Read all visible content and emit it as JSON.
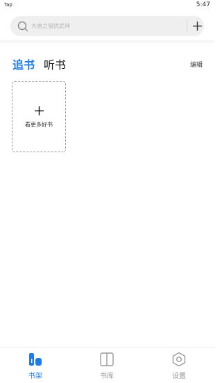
{
  "status_bar": {
    "carrier": "Tap",
    "time": "5:47"
  },
  "search": {
    "placeholder": "大唐之猫扰武神"
  },
  "icons": {
    "search": "search-icon",
    "add": "plus-icon",
    "add_book": "plus-icon",
    "bookshelf": "bookshelf-icon",
    "library": "book-open-icon",
    "settings": "hexagon-gear-icon"
  },
  "tabs": [
    {
      "label": "追书",
      "active": true
    },
    {
      "label": "听书",
      "active": false
    }
  ],
  "edit_label": "编辑",
  "add_card": {
    "label": "看更多好书"
  },
  "bottom_nav": [
    {
      "label": "书架",
      "active": true
    },
    {
      "label": "书库",
      "active": false
    },
    {
      "label": "设置",
      "active": false
    }
  ],
  "colors": {
    "accent": "#1f7be6",
    "inactive": "#999999"
  }
}
